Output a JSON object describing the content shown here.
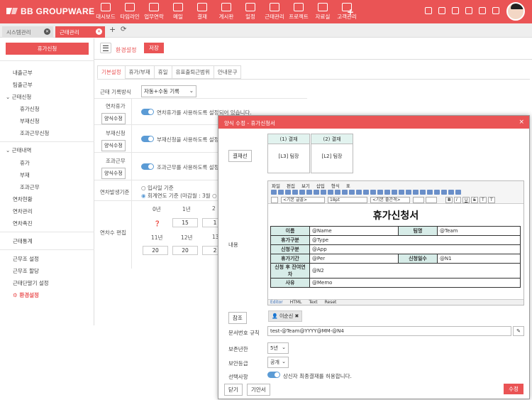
{
  "app": {
    "logo": "BB GROUPWARE"
  },
  "menu": [
    "대시보드",
    "타임라인",
    "업무연락",
    "메일",
    "결재",
    "게시판",
    "일정",
    "근태관리",
    "프로젝트",
    "자료실",
    "고객관리"
  ],
  "tabs": [
    {
      "label": "시스템관리"
    },
    {
      "label": "근태관리"
    }
  ],
  "sidebar": {
    "button": "휴가신청",
    "items": [
      "내출근부",
      "팀출근부",
      "근태신청",
      "휴가신청",
      "부재신청",
      "조과근무신청",
      "근태내역",
      "휴가",
      "부재",
      "조과근무",
      "연차현황",
      "연차관리",
      "연차촉진",
      "근태통계",
      "근무조 설정",
      "근무조 할당",
      "근태단말기 설정",
      "환경설정"
    ]
  },
  "main": {
    "title": "환경설정",
    "save": "저장",
    "subtabs": [
      "기본설정",
      "휴가/부재",
      "휴일",
      "유표출퇴근범위",
      "안내문구"
    ],
    "rows": {
      "record_label": "근태 기록방식",
      "record_value": "자동+수동 기록",
      "leave_label": "연차휴가",
      "leave_btn": "양식수정",
      "leave_text": "연차휴가를 사용하도록 설정되어 있습니다.",
      "absence_label": "부재신청",
      "absence_btn": "양식수정",
      "absence_text": "부재신청을 사용하도록 설정",
      "overtime_label": "조과근무",
      "overtime_btn": "양식수정",
      "overtime_text": "조과근무를 사용하도록 설정",
      "basis_label": "연차발생기준",
      "basis_opt1": "입사일 기준",
      "basis_opt2": "회계연도 기준 (마감월 : 3월",
      "edit_label": "연차수 편집"
    },
    "years": {
      "h1": [
        "0년",
        "1년",
        "2"
      ],
      "v1": [
        "15",
        "1"
      ],
      "h2": [
        "11년",
        "12년",
        "13"
      ],
      "v2": [
        "20",
        "20",
        "2"
      ]
    }
  },
  "modal": {
    "title": "양식 수정 - 휴가신청서",
    "close": "×",
    "approval_btn": "결재선",
    "approvals": [
      {
        "head": "(1) 결재",
        "body": "[L3] 팀장"
      },
      {
        "head": "(2) 결재",
        "body": "[L2] 팀장"
      }
    ],
    "content_label": "내용",
    "editor_menu": [
      "파일",
      "편집",
      "보기",
      "삽입",
      "형식",
      "표"
    ],
    "font_select": "<기본 글꼴>",
    "size_select": "18pt",
    "line_select": "<기본 줄간격>",
    "doc_title": "휴가신청서",
    "doc_rows": [
      [
        "이름",
        "@Name",
        "팀명",
        "@Team"
      ],
      [
        "휴가구분",
        "@Type"
      ],
      [
        "신청구분",
        "@App"
      ],
      [
        "휴가기간",
        "@Per",
        "신청일수",
        "@N1"
      ],
      [
        "신청 후 잔여연차",
        "@N2"
      ],
      [
        "사유",
        "@Memo"
      ]
    ],
    "editor_tabs": [
      "Editor",
      "HTML",
      "Text",
      "Reset"
    ],
    "ref_btn": "참조",
    "ref_chip": "이순신",
    "docno_label": "문서번호 규칙",
    "docno_value": "test-@Team@YYYY@MM-@N4",
    "retention_label": "보존년한",
    "retention_value": "5년",
    "security_label": "보안등급",
    "security_value": "공개",
    "option_label": "선택사항",
    "option_text": "상신자 최종결재를 허용합니다.",
    "close_btn": "닫기",
    "template_btn": "기안서",
    "submit_btn": "수정"
  }
}
